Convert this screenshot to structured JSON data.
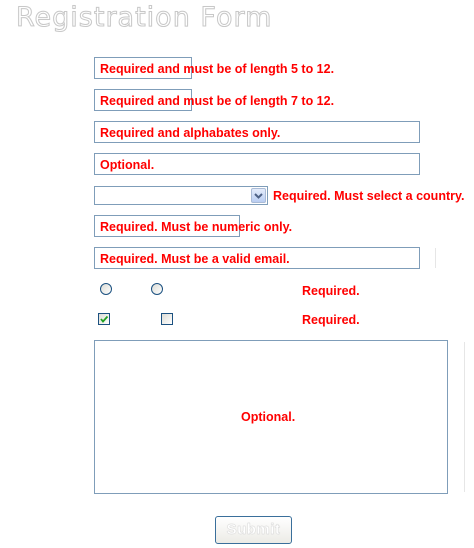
{
  "form": {
    "title": "Registration Form",
    "fields": {
      "userid": {
        "value": "",
        "message": "Required and must be of length 5 to 12."
      },
      "password": {
        "value": "",
        "message": "Required and must be of length 7 to 12."
      },
      "name": {
        "value": "",
        "message": "Required and alphabates only."
      },
      "address": {
        "value": "",
        "message": "Optional."
      },
      "country": {
        "selected": "",
        "message": "Required. Must select a country."
      },
      "zip": {
        "value": "",
        "message": "Required. Must be numeric only."
      },
      "email": {
        "value": "",
        "message": "Required. Must be a valid email."
      },
      "sex": {
        "message": "Required.",
        "option_1_checked": false,
        "option_2_checked": false
      },
      "language": {
        "message": "Required.",
        "option_1_checked": true,
        "option_2_checked": false
      },
      "about": {
        "value": "",
        "message": "Optional."
      }
    },
    "submit_label": "Submit"
  },
  "colors": {
    "error_text": "#ff0000",
    "field_border": "#7f9db9",
    "control_border": "#1c5180",
    "checkmark": "#21a121",
    "select_arrow": "#4d6185"
  }
}
